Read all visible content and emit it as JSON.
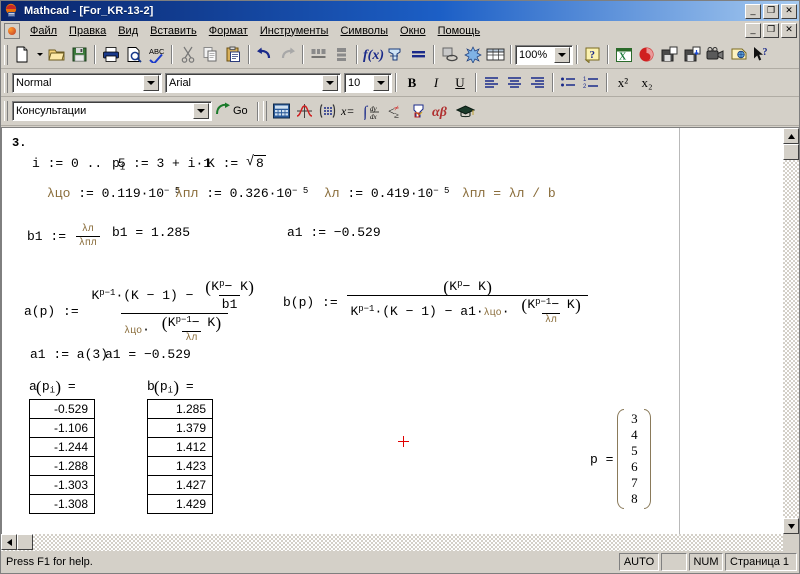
{
  "window": {
    "app_name": "Mathcad",
    "document_name": "For_KR-13-2",
    "title": "Mathcad - [For_KR-13-2]",
    "minimize_label": "_",
    "maximize_label": "❐",
    "close_label": "✕",
    "titlebar_color": "#0a246a"
  },
  "menu": {
    "items": [
      {
        "label": "Файл"
      },
      {
        "label": "Правка"
      },
      {
        "label": "Вид"
      },
      {
        "label": "Вставить"
      },
      {
        "label": "Формат"
      },
      {
        "label": "Инструменты"
      },
      {
        "label": "Символы"
      },
      {
        "label": "Окно"
      },
      {
        "label": "Помощь"
      }
    ]
  },
  "toolbar_standard": {
    "buttons": [
      "new-icon",
      "open-icon",
      "save-icon",
      "print-icon",
      "print-preview-icon",
      "spellcheck-icon",
      "cut-icon",
      "copy-icon",
      "paste-icon",
      "undo-icon",
      "redo-icon",
      "align-across-icon",
      "align-down-icon",
      "insert-function-icon",
      "insert-unit-icon",
      "calculate-icon",
      "insert-hyperlink-icon",
      "component-wizard-icon",
      "insert-matrix-icon"
    ],
    "zoom_value": "100%",
    "help_icon": "help-icon",
    "extra_buttons": [
      "excel-icon",
      "mathconnex-icon",
      "save-web-icon",
      "save-target-icon",
      "animation-icon",
      "collaboratory-icon",
      "context-help-icon"
    ]
  },
  "toolbar_format": {
    "style_value": "Normal",
    "font_value": "Arial",
    "size_value": "10",
    "bold_label": "B",
    "italic_label": "I",
    "underline_label": "U",
    "align_left_icon": "align-left-icon",
    "align_center_icon": "align-center-icon",
    "align_right_icon": "align-right-icon",
    "bullet_list_icon": "bullet-list-icon",
    "number_list_icon": "number-list-icon",
    "superscript_label": "x²",
    "subscript_label": "x₂"
  },
  "toolbar_resources": {
    "resource_value": "Консультации",
    "go_label": "Go",
    "palettes": [
      "calculator-palette-icon",
      "graph-palette-icon",
      "matrix-palette-icon",
      "evaluation-palette-icon",
      "calculus-palette-icon",
      "boolean-palette-icon",
      "programming-palette-icon",
      "greek-palette-icon",
      "symbolic-palette-icon"
    ]
  },
  "document": {
    "region_number": "3.",
    "line_range_var": "i",
    "line_range_expr": "0 ..",
    "line_range_end": "5",
    "p_def_var": "p",
    "p_def_sub": "i",
    "p_def_expr": "3 + i·1",
    "K_var": "K",
    "K_expr": "8",
    "lambda_tso_name": "λцо",
    "lambda_tso_value": "0.119·10",
    "lambda_tso_exp": "− 5",
    "lambda_pl_name": "λпл",
    "lambda_pl_value": "0.326·10",
    "lambda_pl_exp": "− 5",
    "lambda_l_name": "λл",
    "lambda_l_value": "0.419·10",
    "lambda_l_exp": "− 5",
    "lambda_pl_eq": "λпл = λл / b",
    "b1_label": "b1",
    "b1_num": "λл",
    "b1_den": "λпл",
    "b1_result_label": "b1 = 1.285",
    "a1_assign_right": "a1 = −0.529",
    "a_fn_label": "a(p)",
    "b_fn_label": "b(p)",
    "K_pow_p_minus_1": "K",
    "expr_pm1": "p−1",
    "expr_p": "p",
    "expr_K_minus_1": "·(K − 1) −",
    "expr_K_minus_1_plain": "·(K − 1) − a1·",
    "expr_Kp_minus_K": "− K",
    "a1_redef": "a1 := a(3)",
    "a1_result": "a1 = −0.529",
    "table_a_header_fn": "a",
    "table_a_header_arg": "p",
    "table_a_header_sub": "i",
    "table_a_header_eq": "=",
    "table_b_header_fn": "b",
    "table_a_values": [
      "-0.529",
      "-1.106",
      "-1.244",
      "-1.288",
      "-1.303",
      "-1.308"
    ],
    "table_b_values": [
      "1.285",
      "1.379",
      "1.412",
      "1.423",
      "1.427",
      "1.429"
    ],
    "p_vector_label": "p =",
    "p_vector_values": [
      "3",
      "4",
      "5",
      "6",
      "7",
      "8"
    ],
    "cursor_icon": "crosshair-cursor"
  },
  "statusbar": {
    "message": "Press F1 for help.",
    "auto_label": "AUTO",
    "blank_label": "",
    "num_label": "NUM",
    "page_label": "Страница 1"
  },
  "scrollbars": {
    "up_arrow": "▲",
    "down_arrow": "▼",
    "left_arrow": "◄",
    "right_arrow": "►"
  }
}
